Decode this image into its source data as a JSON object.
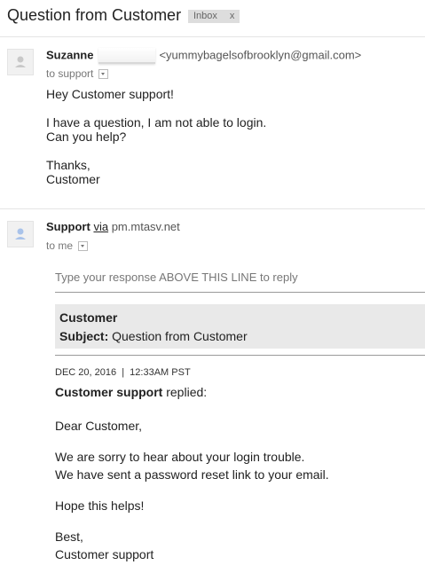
{
  "thread": {
    "subject": "Question from Customer",
    "label": "Inbox",
    "label_close": "x"
  },
  "message1": {
    "sender_name": "Suzanne",
    "sender_email": "<yummybagelsofbrooklyn@gmail.com>",
    "to": "to support",
    "body": [
      "Hey Customer support!",
      "I have a question, I am not able to login.",
      "Can you help?",
      "Thanks,",
      "Customer"
    ]
  },
  "message2": {
    "sender_name": "Support",
    "via_label": "via",
    "via_domain": "pm.mtasv.net",
    "to": "to me",
    "instruction": "Type your response ABOVE THIS LINE to reply",
    "customer_name": "Customer",
    "subject_label": "Subject:",
    "subject_value": "Question from Customer",
    "date": "DEC 20, 2016  |  12:33AM PST",
    "replier": "Customer support",
    "replied_text": "replied:",
    "body": [
      "Dear Customer,",
      "We are sorry to hear about your login trouble.",
      "We have sent a password reset link to your email.",
      "Hope this helps!",
      "Best,",
      "Customer support"
    ]
  },
  "icons": {
    "avatar": "person-icon",
    "dropdown": "chevron-down-icon"
  },
  "colors": {
    "label_bg": "#dddddd",
    "quote_bg": "#e9e9e9"
  }
}
